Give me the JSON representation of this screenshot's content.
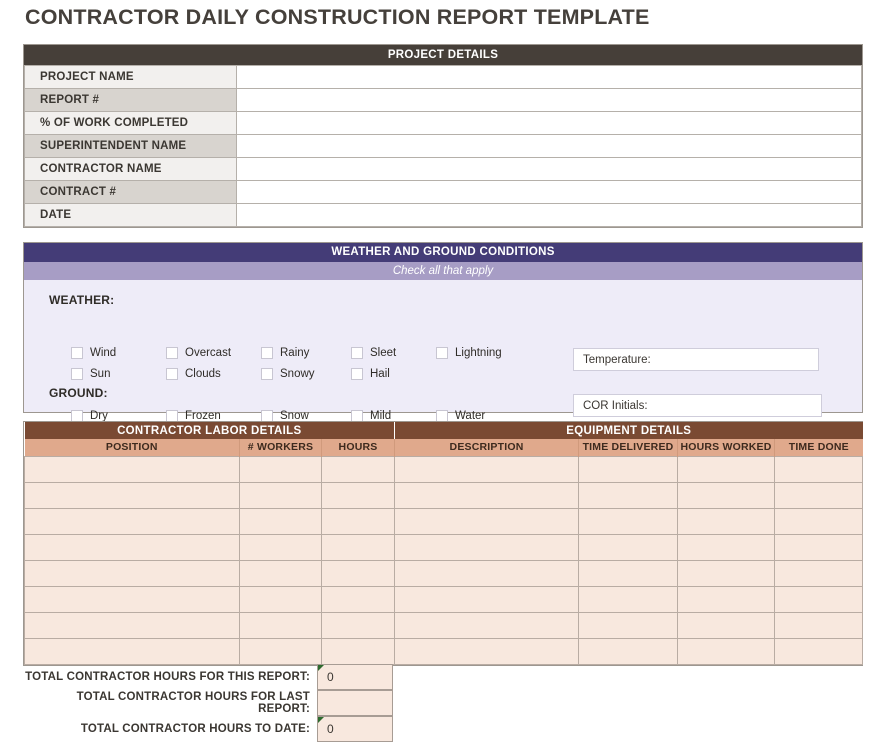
{
  "document": {
    "title": "CONTRACTOR DAILY CONSTRUCTION REPORT TEMPLATE"
  },
  "project_details": {
    "header": "PROJECT DETAILS",
    "rows": [
      {
        "label": "PROJECT NAME",
        "value": ""
      },
      {
        "label": "REPORT #",
        "value": ""
      },
      {
        "label": "% OF WORK COMPLETED",
        "value": ""
      },
      {
        "label": "SUPERINTENDENT NAME",
        "value": ""
      },
      {
        "label": "CONTRACTOR NAME",
        "value": ""
      },
      {
        "label": "CONTRACT #",
        "value": ""
      },
      {
        "label": "DATE",
        "value": ""
      }
    ]
  },
  "weather": {
    "header": "WEATHER AND GROUND CONDITIONS",
    "subheader": "Check all that apply",
    "weather_label": "WEATHER:",
    "ground_label": "GROUND:",
    "weather_options": [
      "Wind",
      "Overcast",
      "Rainy",
      "Sleet",
      "Lightning",
      "Sun",
      "Clouds",
      "Snowy",
      "Hail"
    ],
    "ground_options": [
      "Dry",
      "Frozen",
      "Snow",
      "Mild",
      "Water"
    ],
    "temperature_label": "Temperature:",
    "temperature_value": "",
    "cor_initials_label": "COR Initials:",
    "cor_initials_value": ""
  },
  "labor_equipment": {
    "labor_header": "CONTRACTOR LABOR DETAILS",
    "equipment_header": "EQUIPMENT DETAILS",
    "columns": [
      "POSITION",
      "# WORKERS",
      "HOURS",
      "DESCRIPTION",
      "TIME DELIVERED",
      "HOURS WORKED",
      "TIME DONE"
    ],
    "row_count": 8,
    "rows": [
      {
        "position": "",
        "workers": "",
        "hours": "",
        "description": "",
        "time_delivered": "",
        "hours_worked": "",
        "time_done": ""
      },
      {
        "position": "",
        "workers": "",
        "hours": "",
        "description": "",
        "time_delivered": "",
        "hours_worked": "",
        "time_done": ""
      },
      {
        "position": "",
        "workers": "",
        "hours": "",
        "description": "",
        "time_delivered": "",
        "hours_worked": "",
        "time_done": ""
      },
      {
        "position": "",
        "workers": "",
        "hours": "",
        "description": "",
        "time_delivered": "",
        "hours_worked": "",
        "time_done": ""
      },
      {
        "position": "",
        "workers": "",
        "hours": "",
        "description": "",
        "time_delivered": "",
        "hours_worked": "",
        "time_done": ""
      },
      {
        "position": "",
        "workers": "",
        "hours": "",
        "description": "",
        "time_delivered": "",
        "hours_worked": "",
        "time_done": ""
      },
      {
        "position": "",
        "workers": "",
        "hours": "",
        "description": "",
        "time_delivered": "",
        "hours_worked": "",
        "time_done": ""
      },
      {
        "position": "",
        "workers": "",
        "hours": "",
        "description": "",
        "time_delivered": "",
        "hours_worked": "",
        "time_done": ""
      }
    ]
  },
  "totals": {
    "rows": [
      {
        "label": "TOTAL CONTRACTOR HOURS FOR THIS REPORT:",
        "value": "0",
        "has_comment": true
      },
      {
        "label": "TOTAL CONTRACTOR HOURS FOR LAST REPORT:",
        "value": "",
        "has_comment": false
      },
      {
        "label": "TOTAL CONTRACTOR HOURS TO DATE:",
        "value": "0",
        "has_comment": true
      }
    ]
  },
  "colors": {
    "title_text": "#45403b",
    "project_header_bg": "#463f39",
    "project_row_light": "#f2f0ee",
    "project_row_dark": "#d8d4cf",
    "weather_header_bg": "#443c77",
    "weather_sub_bg": "#a79dc5",
    "weather_body_bg": "#eeecf8",
    "section_header_bg": "#7a4a33",
    "column_header_bg": "#e0a98c",
    "table_cell_bg": "#f8e8de",
    "comment_marker": "#2e6b2e"
  }
}
